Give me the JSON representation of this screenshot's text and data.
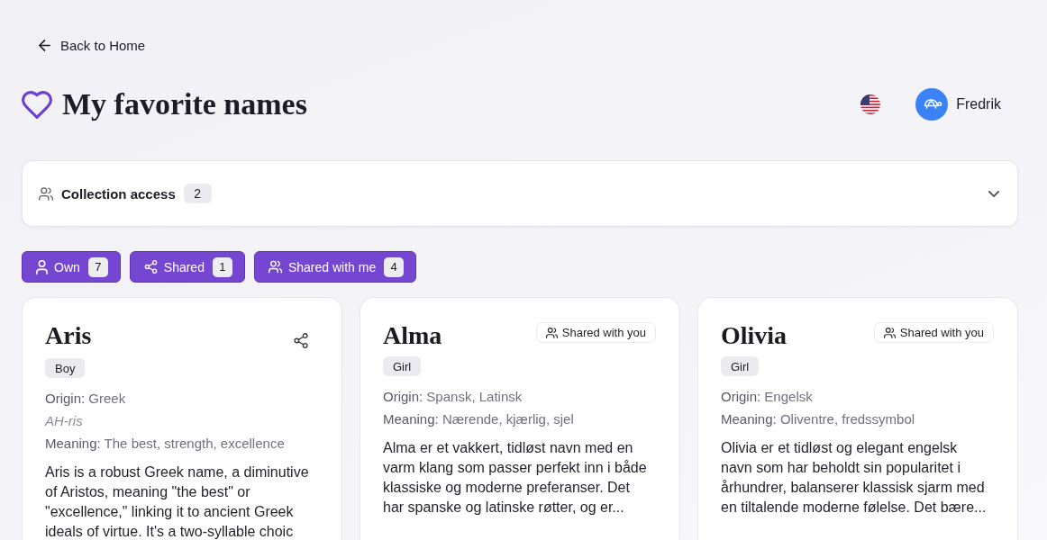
{
  "back_link": {
    "label": "Back to Home"
  },
  "header": {
    "title": "My favorite names",
    "user": {
      "name": "Fredrik"
    }
  },
  "collection_access": {
    "label": "Collection access",
    "count": "2",
    "expanded": false
  },
  "filters": [
    {
      "kind": "own",
      "label": "Own",
      "count": "7",
      "selected": true
    },
    {
      "kind": "shared",
      "label": "Shared",
      "count": "1",
      "selected": true
    },
    {
      "kind": "received",
      "label": "Shared with me",
      "count": "4",
      "selected": true
    }
  ],
  "cards": [
    {
      "kind": "own",
      "name": "Aris",
      "gender": "Boy",
      "origin": {
        "label": "Origin:",
        "value": "Greek"
      },
      "pronunciation": "AH-ris",
      "meaning": {
        "label": "Meaning:",
        "value": "The best, strength, excellence"
      },
      "description": "Aris is a robust Greek name, a diminutive of Aristos, meaning \"the best\" or \"excellence,\" linking it to ancient Greek ideals of virtue. It's a two-syllable choic"
    },
    {
      "kind": "shared",
      "badge": "Shared with you",
      "name": "Alma",
      "gender": "Girl",
      "origin": {
        "label": "Origin:",
        "value": "Spansk, Latinsk"
      },
      "meaning": {
        "label": "Meaning:",
        "value": "Nærende, kjærlig, sjel"
      },
      "description": "Alma er et vakkert, tidløst navn med en varm klang som passer perfekt inn i både klassiske og moderne preferanser. Det har spanske og latinske røtter, og er..."
    },
    {
      "kind": "shared",
      "badge": "Shared with you",
      "name": "Olivia",
      "gender": "Girl",
      "origin": {
        "label": "Origin:",
        "value": "Engelsk"
      },
      "meaning": {
        "label": "Meaning:",
        "value": "Oliventre, fredssymbol"
      },
      "description": "Olivia er et tidløst og elegant engelsk navn som har beholdt sin popularitet i århundrer, balanserer klassisk sjarm med en tiltalende moderne følelse. Det bære..."
    }
  ]
}
